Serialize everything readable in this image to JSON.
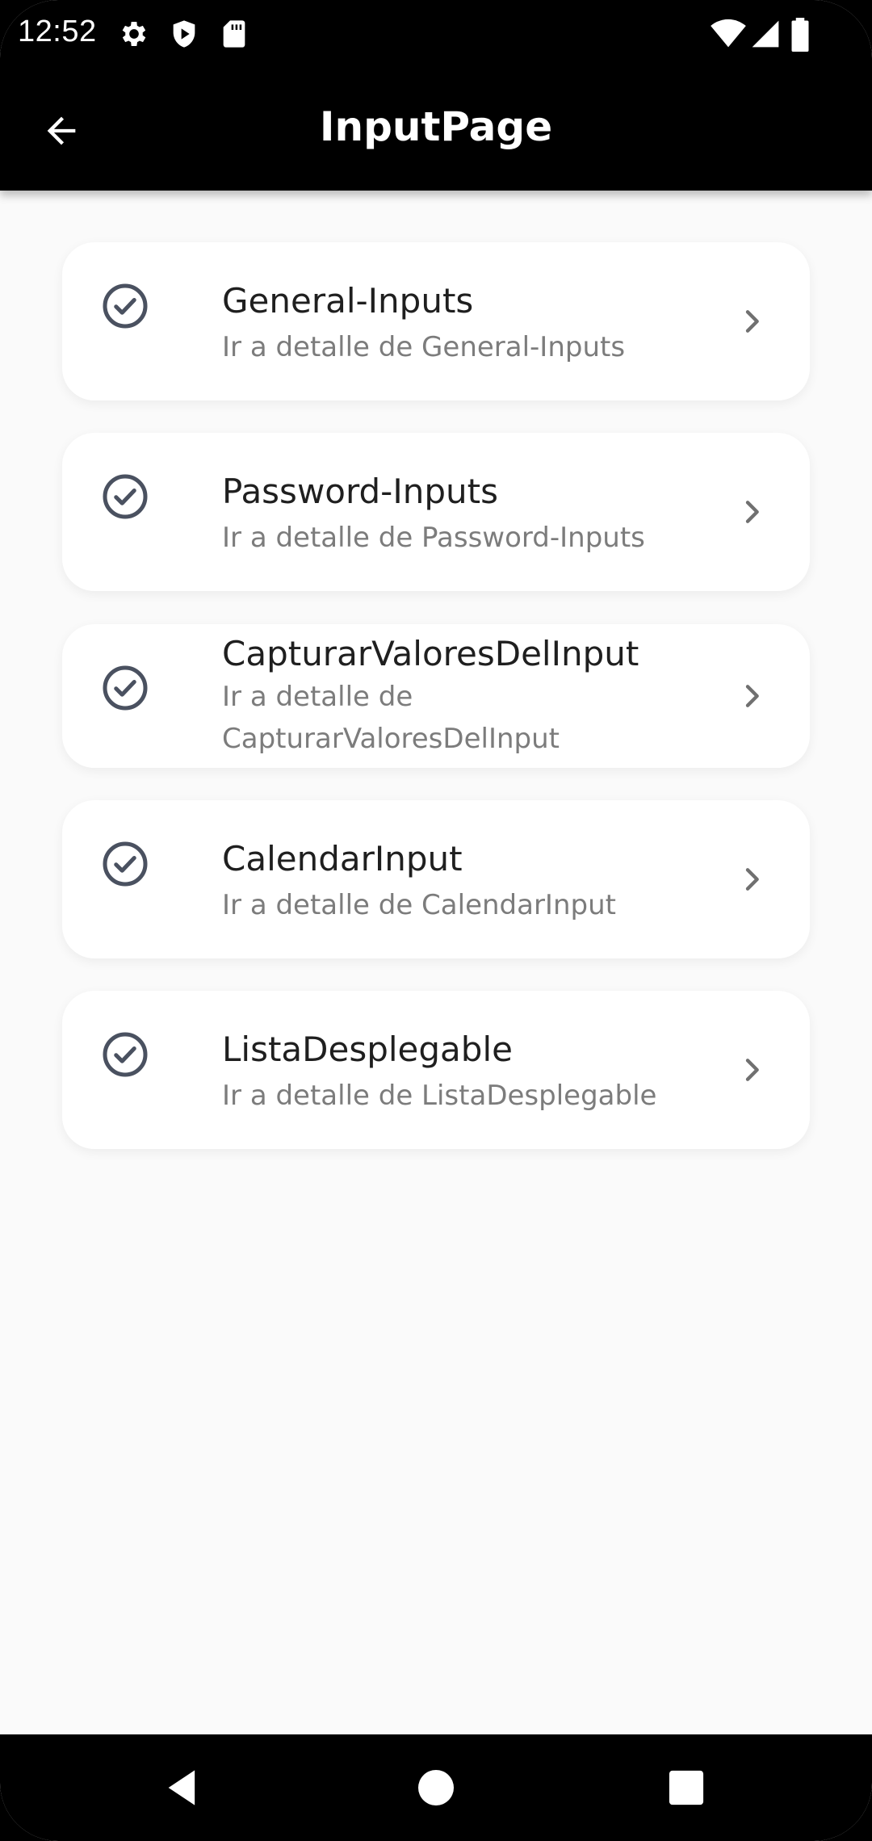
{
  "status_bar": {
    "time": "12:52",
    "left_icons": [
      "gear-icon",
      "shield-play-icon",
      "sd-card-icon"
    ],
    "right_icons": [
      "wifi-icon",
      "signal-icon",
      "battery-icon"
    ]
  },
  "app_bar": {
    "title": "InputPage",
    "back_icon": "arrow-left-icon"
  },
  "list": {
    "items": [
      {
        "title": "General-Inputs",
        "subtitle": "Ir a detalle de General-Inputs"
      },
      {
        "title": "Password-Inputs",
        "subtitle": "Ir a detalle de Password-Inputs"
      },
      {
        "title": "CapturarValoresDelInput",
        "subtitle": "Ir a detalle de CapturarValoresDelInput"
      },
      {
        "title": "CalendarInput",
        "subtitle": "Ir a detalle de CalendarInput"
      },
      {
        "title": "ListaDesplegable",
        "subtitle": "Ir a detalle de ListaDesplegable"
      }
    ],
    "leading_icon": "check-circle-icon",
    "trailing_icon": "chevron-right-icon"
  },
  "nav_bar": {
    "buttons": [
      "back-triangle-icon",
      "home-circle-icon",
      "recents-square-icon"
    ]
  },
  "colors": {
    "bar_background": "#000000",
    "page_background": "#fafafa",
    "card_background": "#ffffff",
    "icon_color": "#4a5160",
    "title_color": "#1f1f1f",
    "subtitle_color": "#7c7c7c"
  }
}
